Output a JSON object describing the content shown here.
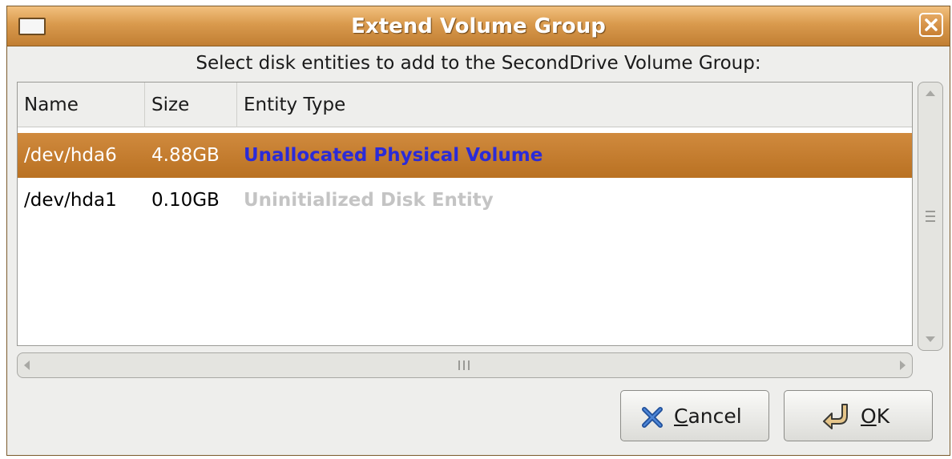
{
  "window": {
    "title": "Extend Volume Group",
    "menu_icon": "window-menu-icon",
    "close_icon": "close-icon"
  },
  "prompt": "Select disk entities to add to the SecondDrive Volume Group:",
  "table": {
    "columns": [
      "Name",
      "Size",
      "Entity Type"
    ],
    "rows": [
      {
        "name": "/dev/hda6",
        "size": "4.88GB",
        "type": "Unallocated Physical Volume",
        "selected": true
      },
      {
        "name": "/dev/hda1",
        "size": "0.10GB",
        "type": "Uninitialized Disk Entity",
        "selected": false
      }
    ]
  },
  "buttons": {
    "cancel": {
      "mnemonic": "C",
      "rest": "ancel",
      "icon": "x-cancel-icon"
    },
    "ok": {
      "mnemonic": "O",
      "rest": "K",
      "icon": "return-arrow-icon"
    }
  },
  "colors": {
    "title_bar": "#d99a4d",
    "selection": "#c57d2f",
    "physical_volume_text": "#3535d6",
    "uninitialized_text": "#c4c4c4"
  }
}
